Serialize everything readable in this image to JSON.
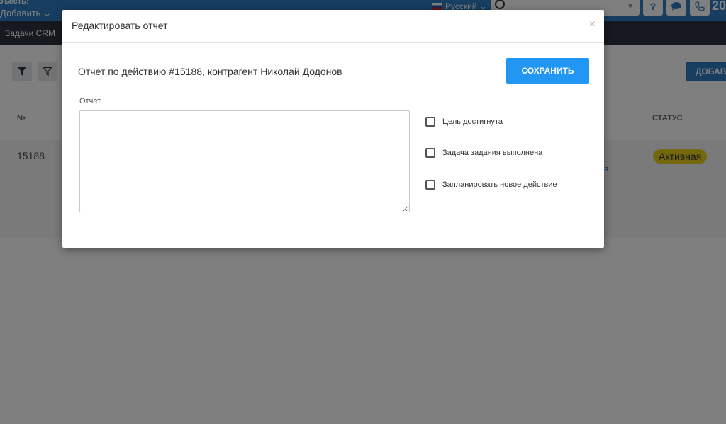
{
  "topbar": {
    "projects_fragment": "оъесть:",
    "add_label": "Добавить",
    "language": "Русский",
    "help_icon": "?",
    "number_fragment": "20"
  },
  "navbar": {
    "tab_label": "Задачи CRM"
  },
  "page": {
    "add_button_label": "ДОБАВ",
    "columns": {
      "number": "№",
      "status": "СТАТУС"
    },
    "row": {
      "id": "15188",
      "status": "Активная"
    }
  },
  "modal": {
    "title": "Редактировать отчет",
    "close_label": "×",
    "report_heading": "Отчет по действию #15188, контрагент Николай Додонов",
    "save_label": "СОХРАНИТЬ",
    "report_field_label": "Отчет",
    "report_value": "",
    "checkboxes": [
      {
        "label": "Цель достигнута",
        "checked": false
      },
      {
        "label": "Задача задания выполнена",
        "checked": false
      },
      {
        "label": "Запланировать новое действие",
        "checked": false
      }
    ]
  },
  "colors": {
    "topbar": "#2f7dc2",
    "navbar": "#2c3440",
    "save_button": "#2196f3",
    "status_badge": "#e8cf1d"
  }
}
